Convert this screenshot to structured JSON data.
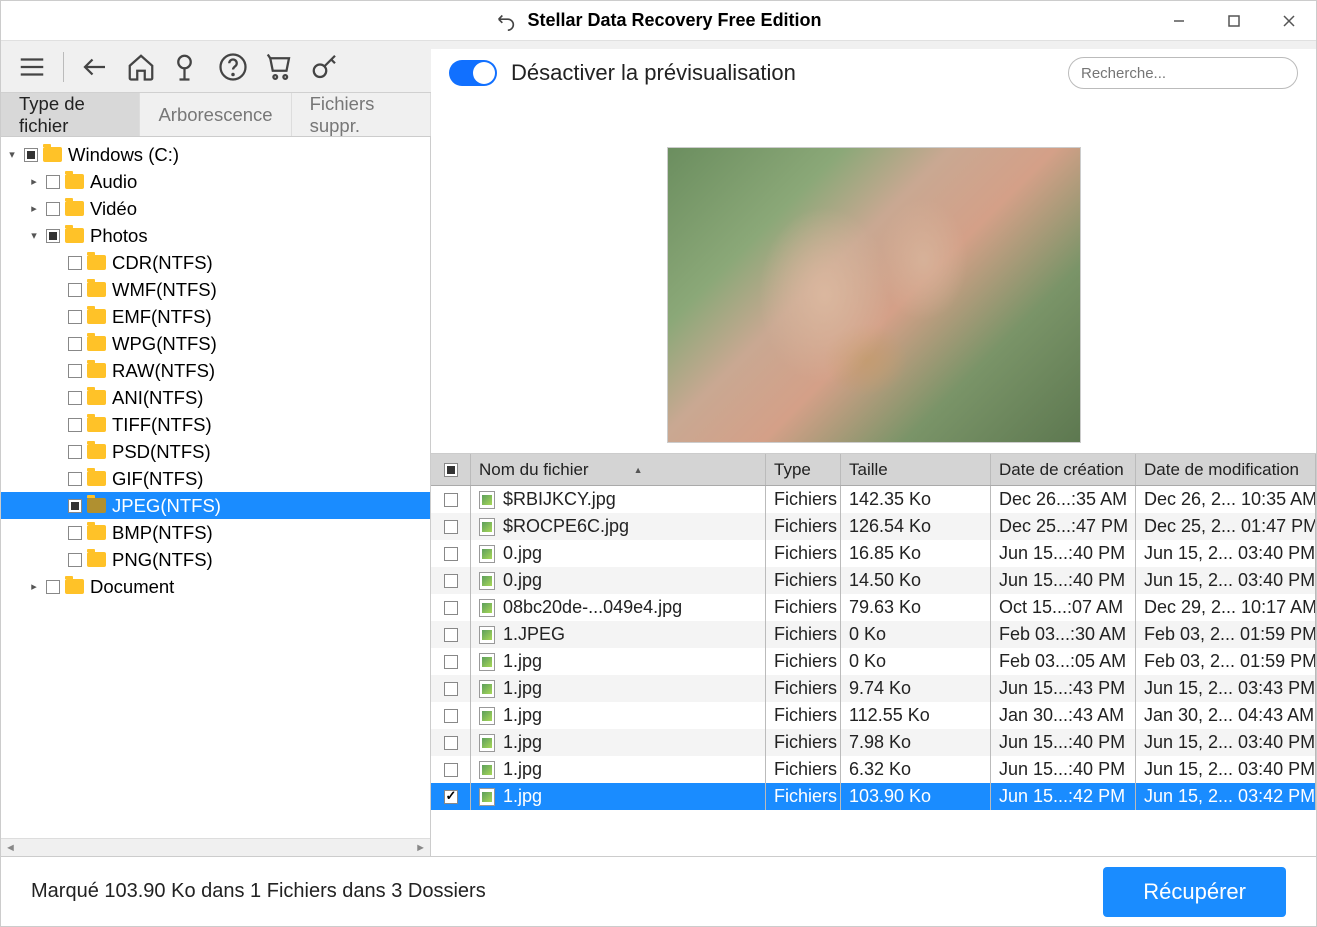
{
  "titlebar": {
    "title": "Stellar Data Recovery Free Edition"
  },
  "brand": {
    "pre": "ste",
    "accent": "ll",
    "post": "ar"
  },
  "tabs": {
    "t0": "Type de fichier",
    "t1": "Arborescence",
    "t2": "Fichiers suppr."
  },
  "preview_toggle_label": "Désactiver la prévisualisation",
  "search": {
    "placeholder": "Recherche..."
  },
  "tree": {
    "root": "Windows (C:)",
    "audio": "Audio",
    "video": "Vidéo",
    "photos": "Photos",
    "document": "Document",
    "photo_items": [
      "CDR(NTFS)",
      "WMF(NTFS)",
      "EMF(NTFS)",
      "WPG(NTFS)",
      "RAW(NTFS)",
      "ANI(NTFS)",
      "TIFF(NTFS)",
      "PSD(NTFS)",
      "GIF(NTFS)",
      "JPEG(NTFS)",
      "BMP(NTFS)",
      "PNG(NTFS)"
    ]
  },
  "columns": {
    "name": "Nom du fichier",
    "type": "Type",
    "size": "Taille",
    "created": "Date de création",
    "modified": "Date de modification"
  },
  "files": [
    {
      "name": "$RBIJKCY.jpg",
      "type": "Fichiers",
      "size": "142.35 Ko",
      "created": "Dec 26...:35 AM",
      "modified": "Dec 26, 2... 10:35 AM",
      "checked": false
    },
    {
      "name": "$ROCPE6C.jpg",
      "type": "Fichiers",
      "size": "126.54 Ko",
      "created": "Dec 25...:47 PM",
      "modified": "Dec 25, 2... 01:47 PM",
      "checked": false
    },
    {
      "name": "0.jpg",
      "type": "Fichiers",
      "size": "16.85 Ko",
      "created": "Jun 15...:40 PM",
      "modified": "Jun 15, 2... 03:40 PM",
      "checked": false
    },
    {
      "name": "0.jpg",
      "type": "Fichiers",
      "size": "14.50 Ko",
      "created": "Jun 15...:40 PM",
      "modified": "Jun 15, 2... 03:40 PM",
      "checked": false
    },
    {
      "name": "08bc20de-...049e4.jpg",
      "type": "Fichiers",
      "size": "79.63 Ko",
      "created": "Oct 15...:07 AM",
      "modified": "Dec 29, 2... 10:17 AM",
      "checked": false
    },
    {
      "name": "1.JPEG",
      "type": "Fichiers",
      "size": "0 Ko",
      "created": "Feb 03...:30 AM",
      "modified": "Feb 03, 2... 01:59 PM",
      "checked": false
    },
    {
      "name": "1.jpg",
      "type": "Fichiers",
      "size": "0 Ko",
      "created": "Feb 03...:05 AM",
      "modified": "Feb 03, 2... 01:59 PM",
      "checked": false
    },
    {
      "name": "1.jpg",
      "type": "Fichiers",
      "size": "9.74 Ko",
      "created": "Jun 15...:43 PM",
      "modified": "Jun 15, 2... 03:43 PM",
      "checked": false
    },
    {
      "name": "1.jpg",
      "type": "Fichiers",
      "size": "112.55 Ko",
      "created": "Jan 30...:43 AM",
      "modified": "Jan 30, 2... 04:43 AM",
      "checked": false
    },
    {
      "name": "1.jpg",
      "type": "Fichiers",
      "size": "7.98 Ko",
      "created": "Jun 15...:40 PM",
      "modified": "Jun 15, 2... 03:40 PM",
      "checked": false
    },
    {
      "name": "1.jpg",
      "type": "Fichiers",
      "size": "6.32 Ko",
      "created": "Jun 15...:40 PM",
      "modified": "Jun 15, 2... 03:40 PM",
      "checked": false
    },
    {
      "name": "1.jpg",
      "type": "Fichiers",
      "size": "103.90 Ko",
      "created": "Jun 15...:42 PM",
      "modified": "Jun 15, 2... 03:42 PM",
      "checked": true,
      "selected": true
    }
  ],
  "footer": {
    "status": "Marqué 103.90 Ko dans 1 Fichiers dans 3 Dossiers",
    "recover": "Récupérer"
  }
}
